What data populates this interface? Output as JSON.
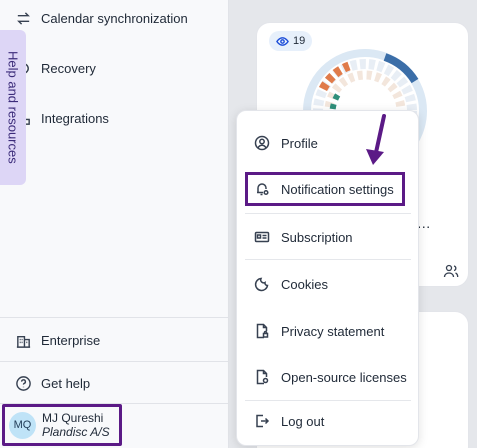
{
  "sidebar": {
    "help_tab_label": "Help and resources",
    "items": [
      {
        "label": "Calendar synchronization",
        "icon": "sync-arrows-icon"
      },
      {
        "label": "Recovery",
        "icon": "recovery-icon"
      },
      {
        "label": "Integrations",
        "icon": "integrations-icon"
      }
    ],
    "bottom_items": [
      {
        "label": "Enterprise",
        "icon": "building-icon"
      },
      {
        "label": "Get help",
        "icon": "question-circle-icon"
      }
    ],
    "user": {
      "initials": "MQ",
      "name": "MJ Qureshi",
      "organization": "Plandisc A/S"
    }
  },
  "card": {
    "views_count": "19",
    "truncated_title": "n…"
  },
  "menu": {
    "items": [
      {
        "label": "Profile",
        "icon": "user-circle-icon"
      },
      {
        "label": "Notification settings",
        "icon": "bell-settings-icon"
      },
      {
        "label": "Subscription",
        "icon": "id-card-icon"
      },
      {
        "label": "Cookies",
        "icon": "cookie-icon"
      },
      {
        "label": "Privacy statement",
        "icon": "document-lock-icon"
      },
      {
        "label": "Open-source licenses",
        "icon": "document-license-icon"
      },
      {
        "label": "Log out",
        "icon": "logout-icon"
      }
    ]
  },
  "colors": {
    "highlight": "#5b1a86",
    "avatar_bg": "#bfe3f7",
    "help_tab_bg": "#ddd6f6",
    "accent_blue": "#1d4ed8"
  }
}
